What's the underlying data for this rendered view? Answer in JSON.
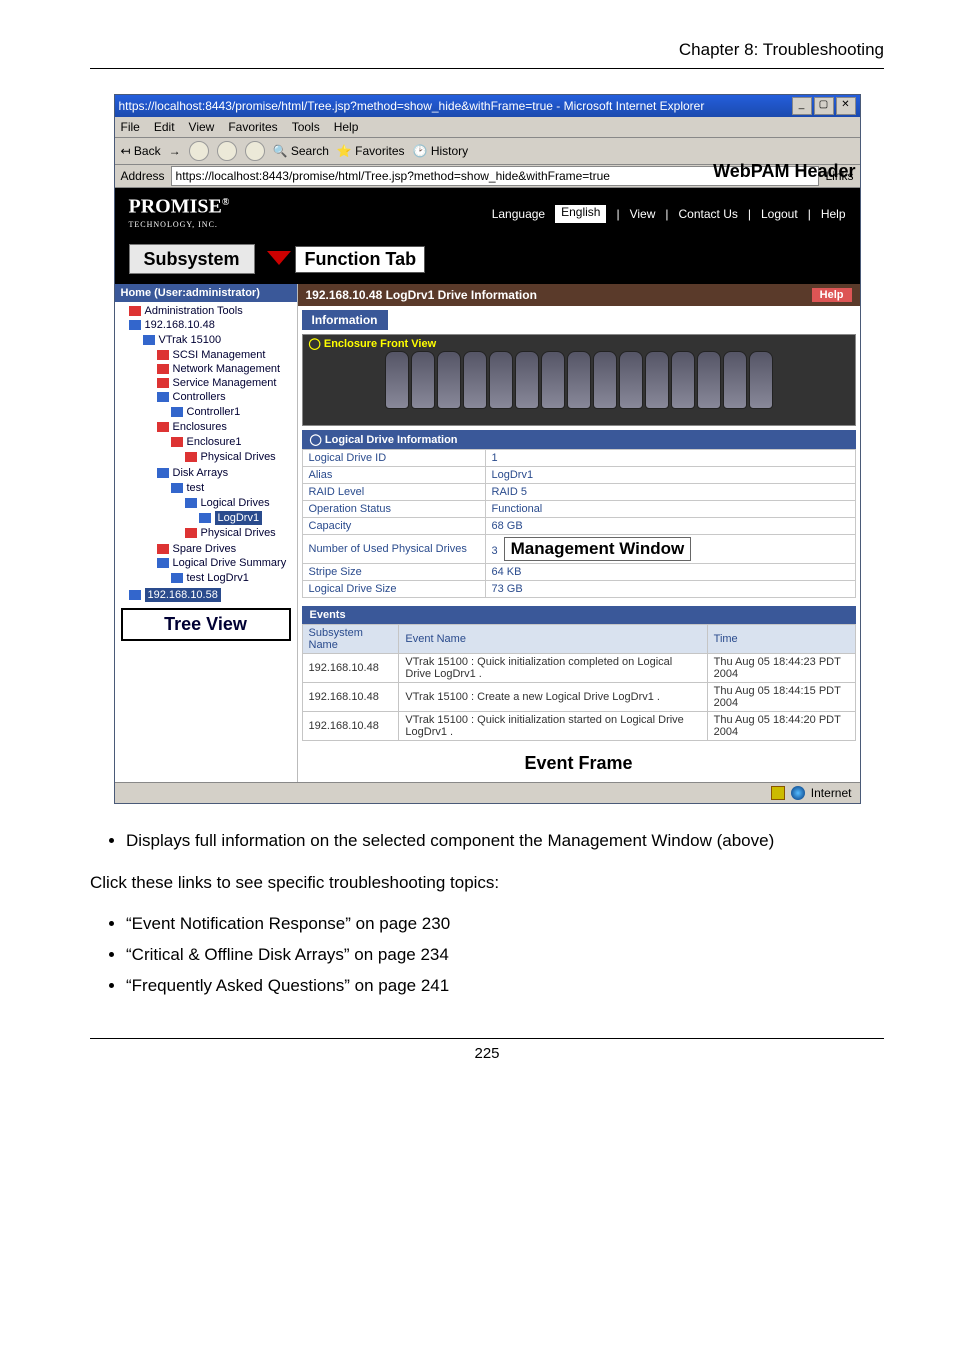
{
  "doc": {
    "chapter": "Chapter 8: Troubleshooting",
    "page_number": "225",
    "caption": "Displays full information on the selected component the Management Window (above)",
    "lead": "Click these links to see specific troubleshooting topics:",
    "links": [
      "“Event Notification Response” on page 230",
      "“Critical & Offline Disk Arrays” on page 234",
      "“Frequently Asked Questions” on page 241"
    ]
  },
  "ie": {
    "title": "https://localhost:8443/promise/html/Tree.jsp?method=show_hide&withFrame=true - Microsoft Internet Explorer",
    "menus": [
      "File",
      "Edit",
      "View",
      "Favorites",
      "Tools",
      "Help"
    ],
    "toolbar": {
      "back": "Back",
      "search": "Search",
      "favorites": "Favorites",
      "history": "History"
    },
    "address_label": "Address",
    "address": "https://localhost:8443/promise/html/Tree.jsp?method=show_hide&withFrame=true",
    "links_label": "Links",
    "status_zone": "Internet"
  },
  "callouts": {
    "header": "WebPAM Header",
    "subsystem": "Subsystem",
    "function_tab": "Function Tab",
    "tree_view": "Tree View",
    "mgmt_window": "Management Window",
    "event_frame": "Event Frame"
  },
  "top": {
    "brand": "PROMISE",
    "brand_sub": "TECHNOLOGY, INC.",
    "language_label": "Language",
    "language_value": "English",
    "links": [
      "View",
      "Contact Us",
      "Logout",
      "Help"
    ]
  },
  "tree": {
    "home": "Home (User:administrator)",
    "admin": "Administration Tools",
    "host_ip": "192.168.10.48",
    "items": [
      "VTrak 15100",
      "SCSI Management",
      "Network Management",
      "Service Management",
      "Controllers",
      "Controller1",
      "Enclosures",
      "Enclosure1",
      "Physical Drives",
      "Disk Arrays",
      "test",
      "Logical Drives",
      "LogDrv1",
      "Physical Drives",
      "Spare Drives",
      "Logical Drive Summary",
      "test LogDrv1"
    ],
    "sel_ip": "192.168.10.58"
  },
  "mgmt": {
    "crumb": "192.168.10.48 LogDrv1   Drive Information",
    "help": "Help",
    "info_tab": "Information",
    "enc_title": "Enclosure Front View",
    "ld_title": "Logical Drive Information",
    "rows": [
      {
        "k": "Logical Drive ID",
        "v": "1"
      },
      {
        "k": "Alias",
        "v": "LogDrv1"
      },
      {
        "k": "RAID Level",
        "v": "RAID 5"
      },
      {
        "k": "Operation Status",
        "v": "Functional"
      },
      {
        "k": "Capacity",
        "v": "68 GB"
      },
      {
        "k": "Number of Used Physical Drives",
        "v": "3"
      },
      {
        "k": "Stripe Size",
        "v": "64 KB"
      },
      {
        "k": "Logical Drive Size",
        "v": "73 GB"
      }
    ],
    "events_hdr": "Events",
    "events_cols": [
      "Subsystem Name",
      "Event Name",
      "Time"
    ],
    "events": [
      {
        "s": "192.168.10.48",
        "e": "VTrak 15100 : Quick initialization completed on Logical Drive LogDrv1 .",
        "t": "Thu Aug 05 18:44:23 PDT 2004"
      },
      {
        "s": "192.168.10.48",
        "e": "VTrak 15100 : Create a new Logical Drive LogDrv1 .",
        "t": "Thu Aug 05 18:44:15 PDT 2004"
      },
      {
        "s": "192.168.10.48",
        "e": "VTrak 15100 : Quick initialization started on Logical Drive LogDrv1 .",
        "t": "Thu Aug 05 18:44:20 PDT 2004"
      }
    ]
  }
}
